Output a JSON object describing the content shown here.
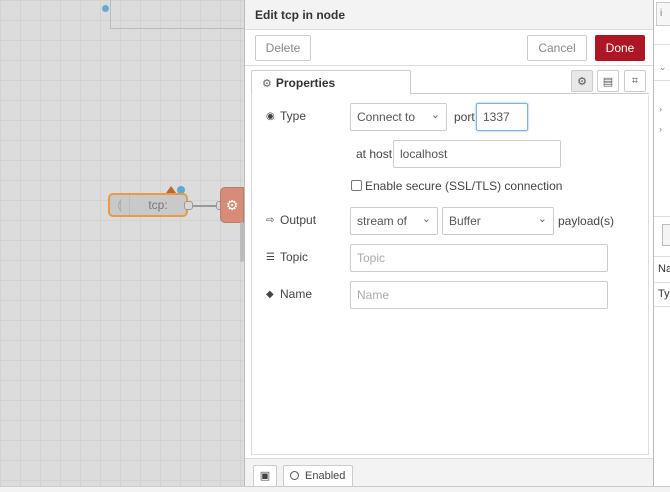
{
  "workspace": {
    "nodes": [
      {
        "label": "tcp:",
        "icon": "network-icon"
      },
      {
        "icon": "gear-icon"
      }
    ]
  },
  "tray": {
    "title": "Edit tcp in node",
    "buttons": {
      "delete": "Delete",
      "cancel": "Cancel",
      "done": "Done"
    },
    "tabs": {
      "properties": "Properties"
    },
    "form": {
      "type_label": "Type",
      "type_value": "Connect to",
      "port_label": "port",
      "port_value": "1337",
      "host_label": "at host",
      "host_value": "localhost",
      "tls_label": "Enable secure (SSL/TLS) connection",
      "tls_checked": false,
      "output_label": "Output",
      "output_mode": "stream of",
      "output_type": "Buffer",
      "output_suffix": "payload(s)",
      "topic_label": "Topic",
      "topic_placeholder": "Topic",
      "name_label": "Name",
      "name_placeholder": "Name"
    },
    "footer": {
      "enabled_label": "Enabled"
    }
  },
  "sidebar": {
    "rows": [
      "Na",
      "Ty"
    ]
  },
  "colors": {
    "done_button": "#ad1625",
    "node_selected_border": "#e99a47",
    "function_node": "#d78b79",
    "status_dot": "#58a8d8"
  }
}
